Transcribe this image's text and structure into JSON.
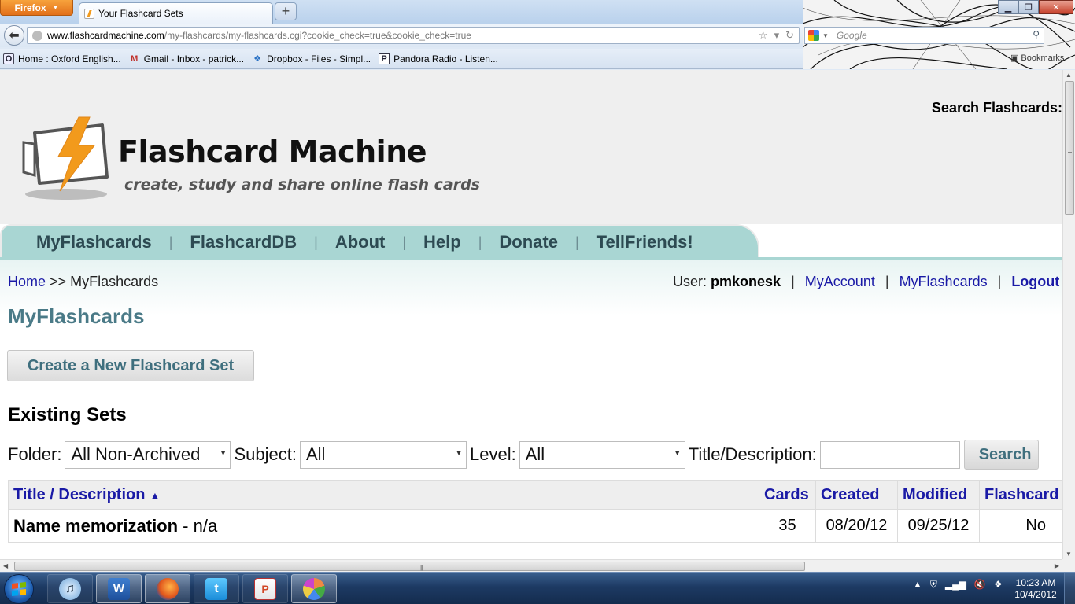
{
  "browser": {
    "app_button": "Firefox",
    "tab_title": "Your Flashcard Sets",
    "new_tab_glyph": "+",
    "url_host": "www.flashcardmachine.com",
    "url_path": "/my-flashcards/my-flashcards.cgi?cookie_check=true&cookie_check=true",
    "search_placeholder": "Google",
    "bookmarks": [
      {
        "label": "Home : Oxford English...",
        "icon": "oxford-icon"
      },
      {
        "label": "Gmail - Inbox - patrick...",
        "icon": "gmail-icon"
      },
      {
        "label": "Dropbox - Files - Simpl...",
        "icon": "dropbox-icon"
      },
      {
        "label": "Pandora Radio - Listen...",
        "icon": "pandora-icon"
      }
    ],
    "bookmarks_menu_label": "Bookmarks"
  },
  "site": {
    "logo_title": "Flashcard Machine",
    "logo_tagline": "create, study and share online flash cards",
    "search_title": "Search Flashcards:",
    "menu": [
      "MyFlashcards",
      "FlashcardDB",
      "About",
      "Help",
      "Donate",
      "TellFriends!"
    ],
    "menu_separator": "|"
  },
  "breadcrumb": {
    "home": "Home",
    "sep": ">>",
    "current": "MyFlashcards"
  },
  "userbar": {
    "user_label": "User:",
    "username": "pmkonesk",
    "links": [
      "MyAccount",
      "MyFlashcards",
      "Logout"
    ],
    "pipe": "|"
  },
  "page": {
    "title": "MyFlashcards",
    "create_button": "Create a New Flashcard Set",
    "sets_title": "Existing Sets"
  },
  "filters": {
    "folder_label": "Folder:",
    "folder_value": "All Non-Archived",
    "subject_label": "Subject:",
    "subject_value": "All",
    "level_label": "Level:",
    "level_value": "All",
    "title_label": "Title/Description:",
    "title_value": "",
    "search_button": "Search"
  },
  "table": {
    "headers": [
      "Title / Description",
      "Cards",
      "Created",
      "Modified",
      "Flashcard"
    ],
    "sort_indicator": "▲",
    "rows": [
      {
        "title": "Name memorization",
        "desc_sep": " - ",
        "description": "n/a",
        "cards": "35",
        "created": "08/20/12",
        "modified": "09/25/12",
        "flashcard": "No"
      }
    ]
  },
  "taskbar": {
    "apps": [
      {
        "name": "iTunes",
        "icon": "itunes-icon",
        "glyph": "♫"
      },
      {
        "name": "Microsoft Word",
        "icon": "word-icon",
        "glyph": "W"
      },
      {
        "name": "Firefox",
        "icon": "firefox-icon",
        "glyph": ""
      },
      {
        "name": "Twitter",
        "icon": "twitter-icon",
        "glyph": "t"
      },
      {
        "name": "PowerPoint",
        "icon": "powerpoint-icon",
        "glyph": "P"
      },
      {
        "name": "Paint",
        "icon": "paint-icon",
        "glyph": ""
      }
    ],
    "time": "10:23 AM",
    "date": "10/4/2012"
  }
}
